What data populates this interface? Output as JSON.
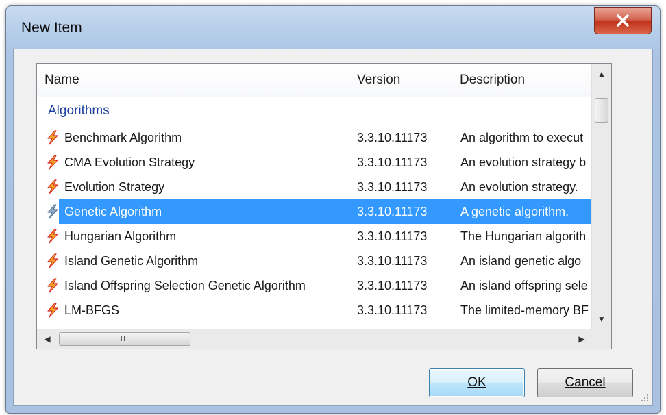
{
  "window": {
    "title": "New Item",
    "close_glyph": "X"
  },
  "list": {
    "columns": [
      "Name",
      "Version",
      "Description"
    ],
    "group": "Algorithms",
    "rows": [
      {
        "name": "Benchmark Algorithm",
        "version": "3.3.10.11173",
        "description": "An algorithm to execut",
        "selected": false
      },
      {
        "name": "CMA Evolution Strategy",
        "version": "3.3.10.11173",
        "description": "An evolution strategy b",
        "selected": false
      },
      {
        "name": "Evolution Strategy",
        "version": "3.3.10.11173",
        "description": "An evolution strategy.",
        "selected": false
      },
      {
        "name": "Genetic Algorithm",
        "version": "3.3.10.11173",
        "description": "A genetic algorithm.",
        "selected": true
      },
      {
        "name": "Hungarian Algorithm",
        "version": "3.3.10.11173",
        "description": "The Hungarian algorith",
        "selected": false
      },
      {
        "name": "Island Genetic Algorithm",
        "version": "3.3.10.11173",
        "description": "An island genetic algo",
        "selected": false
      },
      {
        "name": "Island Offspring Selection Genetic Algorithm",
        "version": "3.3.10.11173",
        "description": "An island offspring sele",
        "selected": false
      },
      {
        "name": "LM-BFGS",
        "version": "3.3.10.11173",
        "description": "The limited-memory BF",
        "selected": false
      }
    ],
    "hscroll_thumb_grip": "III"
  },
  "buttons": {
    "ok_label": "OK",
    "cancel_label": "Cancel"
  },
  "icons": {
    "row_icon": "lightning-bolt-icon"
  },
  "colors": {
    "selection": "#3399ff",
    "group_text": "#1e3fa0",
    "icon_orange": "#f5a623",
    "icon_red": "#d9302a"
  }
}
